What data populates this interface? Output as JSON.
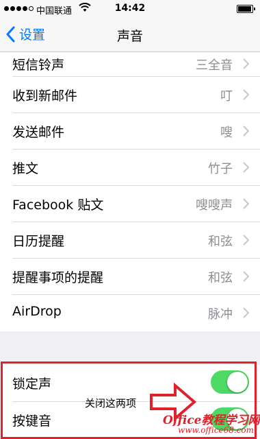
{
  "status": {
    "carrier": "中国联通",
    "time": "14:42"
  },
  "nav": {
    "back_label": "设置",
    "title": "声音"
  },
  "sound_rows": [
    {
      "label": "短信铃声",
      "value": "三全音"
    },
    {
      "label": "收到新邮件",
      "value": "叮"
    },
    {
      "label": "发送邮件",
      "value": "嗖"
    },
    {
      "label": "推文",
      "value": "竹子"
    },
    {
      "label": "Facebook 贴文",
      "value": "嗖嗖声"
    },
    {
      "label": "日历提醒",
      "value": "和弦"
    },
    {
      "label": "提醒事项的提醒",
      "value": "和弦"
    },
    {
      "label": "AirDrop",
      "value": "脉冲"
    }
  ],
  "toggles": [
    {
      "label": "锁定声",
      "on": true
    },
    {
      "label": "按键音",
      "on": true
    }
  ],
  "annotation": {
    "text": "关闭这两项"
  },
  "watermark": {
    "line1": "Office教程学习网",
    "line2": "www.office68.com"
  },
  "colors": {
    "accent": "#007aff",
    "toggle_on": "#4cd964",
    "highlight": "#e0212b"
  }
}
